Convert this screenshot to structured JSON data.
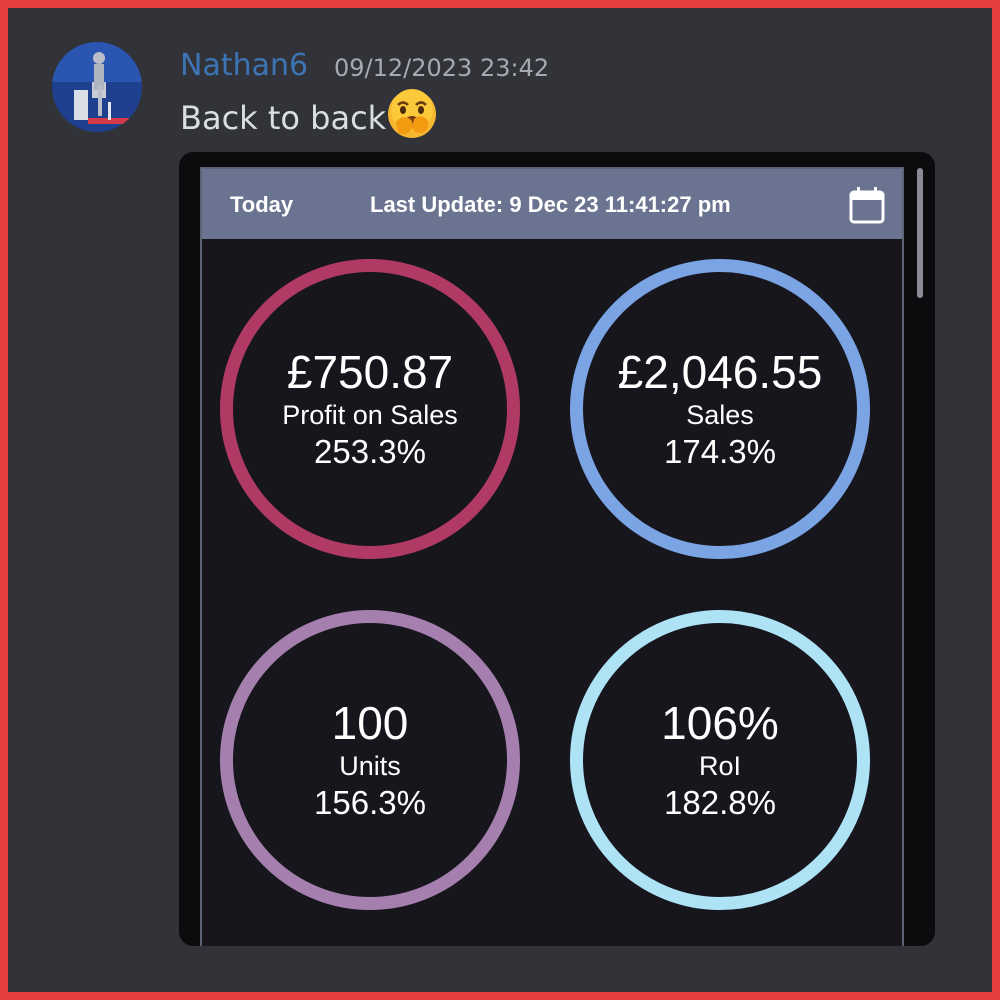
{
  "message": {
    "username": "Nathan6",
    "timestamp": "09/12/2023 23:42",
    "text": "Back to back",
    "emoji": "face-with-hand-over-mouth-emoji"
  },
  "dashboard": {
    "period_label": "Today",
    "last_update": "Last Update: 9 Dec 23 11:41:27 pm",
    "calendar_icon": "calendar-icon",
    "metrics": [
      {
        "value": "£750.87",
        "label": "Profit on Sales",
        "change": "253.3%",
        "color": "#b03a63"
      },
      {
        "value": "£2,046.55",
        "label": "Sales",
        "change": "174.3%",
        "color": "#7ba4e4"
      },
      {
        "value": "100",
        "label": "Units",
        "change": "156.3%",
        "color": "#a57fae"
      },
      {
        "value": "106%",
        "label": "RoI",
        "change": "182.8%",
        "color": "#aee3f6"
      }
    ]
  },
  "colors": {
    "background": "#313338",
    "border": "#e53f3f",
    "username": "#3d74b5",
    "topbar": "#6a7490"
  }
}
